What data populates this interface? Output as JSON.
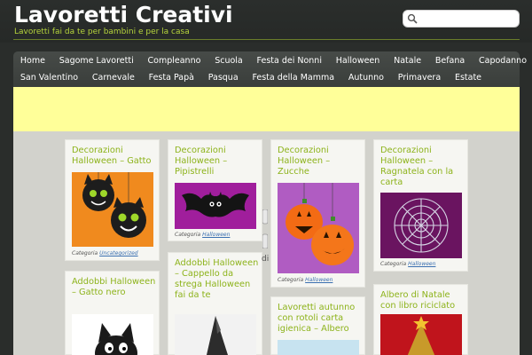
{
  "site": {
    "title": "Lavoretti Creativi",
    "tagline": "Lavoretti fai da te per bambini e per la casa"
  },
  "search": {
    "placeholder": "",
    "icon": "search-icon"
  },
  "nav": {
    "row1": [
      "Home",
      "Sagome Lavoretti",
      "Compleanno",
      "Scuola",
      "Festa dei Nonni",
      "Halloween",
      "Natale",
      "Befana",
      "Capodanno"
    ],
    "row2": [
      "San Valentino",
      "Carnevale",
      "Festa Papà",
      "Pasqua",
      "Festa della Mamma",
      "Autunno",
      "Primavera",
      "Estate"
    ]
  },
  "cards": [
    {
      "title": "Decorazioni Halloween – Gatto",
      "category_prefix": "Categoria",
      "category": "Uncategorized"
    },
    {
      "title": "Decorazioni Halloween – Pipistrelli",
      "category_prefix": "Categoria",
      "category": "Halloween"
    },
    {
      "title": "Decorazioni Halloween – Zucche",
      "category_prefix": "Categoria",
      "category": "Halloween"
    },
    {
      "title": "Decorazioni Halloween – Ragnatela con la carta",
      "category_prefix": "Categoria",
      "category": "Halloween"
    },
    {
      "title": "Addobbi Halloween – Gatto nero"
    },
    {
      "title": "Addobbi Halloween – Cappello da strega Halloween fai da te"
    },
    {
      "title": "Lavoretti autunno con rotoli carta igienica – Albero"
    },
    {
      "title": "Albero di Natale con libro riciclato"
    }
  ],
  "stray_text": "di",
  "colors": {
    "accent": "#8db31b",
    "banner": "#ffff99",
    "header_bg": "#2a2d2b"
  }
}
